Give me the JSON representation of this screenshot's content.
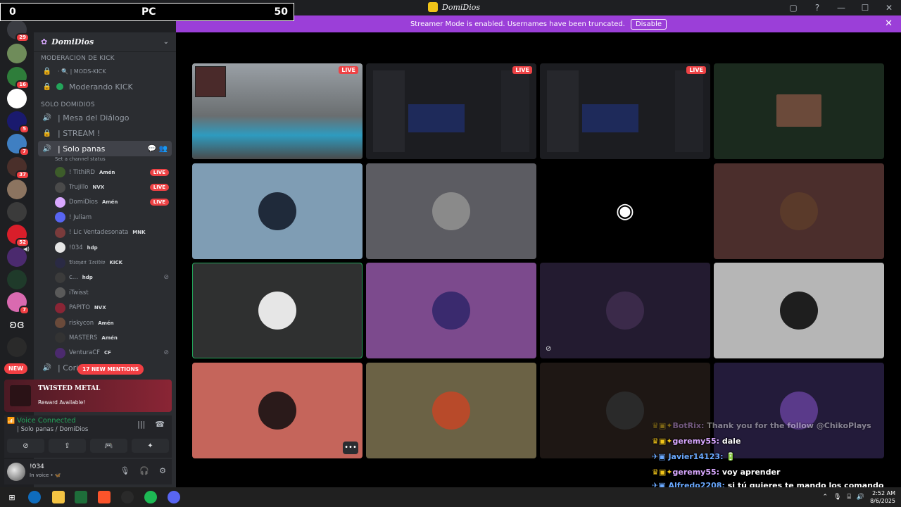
{
  "window": {
    "title": "DomiDios",
    "controls": [
      "▢",
      "?",
      "—",
      "☐",
      "✕"
    ]
  },
  "score_overlay": {
    "left": "0",
    "mid": "PC",
    "right": "50"
  },
  "streamer_bar": {
    "message": "Streamer Mode is enabled. Usernames have been truncated.",
    "button": "Disable",
    "close": "✕"
  },
  "server_rail": {
    "badges": [
      "29",
      "16",
      "5",
      "7",
      "37",
      "52",
      "7"
    ],
    "new_label": "NEW"
  },
  "sidebar": {
    "server_name": "DomiDios",
    "categories": [
      "MODERACION DE KICK",
      "SOLO DOMIDIOS"
    ],
    "channels_mod": [
      {
        "icon": "🔒",
        "label": "· 🔍 | MODS-KICK"
      },
      {
        "icon": "🔒",
        "label": "Moderando KICK"
      }
    ],
    "channels_solo": [
      {
        "icon": "🔊",
        "label": "| Mesa del Diálogo"
      },
      {
        "icon": "🔒",
        "label": "| STREAM !"
      },
      {
        "icon": "🔊",
        "label": "| Solo panas"
      }
    ],
    "channel_status": "Set a channel status",
    "voice_users": [
      {
        "name": "! TithiRD",
        "tag": "Amén",
        "live": "LIVE"
      },
      {
        "name": "Trujillo",
        "tag": "NVX",
        "live": "LIVE"
      },
      {
        "name": "DomiDios",
        "tag": "Amén",
        "live": "LIVE"
      },
      {
        "name": "! Juliam",
        "tag": "",
        "live": ""
      },
      {
        "name": "! Lic Ventadesonata",
        "tag": "MNK",
        "live": ""
      },
      {
        "name": "!034",
        "tag": "hdp",
        "live": ""
      },
      {
        "name": "𝔅𝔯𝔞𝔶𝔞𝔫 𝔗𝔬𝔯𝔦𝔟𝔦𝔬",
        "tag": "KICK",
        "live": ""
      },
      {
        "name": "c...",
        "tag": "hdp",
        "live": ""
      },
      {
        "name": "iTwisst",
        "tag": "",
        "live": ""
      },
      {
        "name": "PAPITO",
        "tag": "NVX",
        "live": ""
      },
      {
        "name": "riskycon",
        "tag": "Amén",
        "live": ""
      },
      {
        "name": "MASTERS",
        "tag": "Amén",
        "live": ""
      },
      {
        "name": "VenturaCF",
        "tag": "CF",
        "live": ""
      }
    ],
    "last_channel": "| Corito",
    "mentions_pill": "17 NEW MENTIONS"
  },
  "reward": {
    "title": "TWISTED METAL",
    "subtitle": "Reward Available!"
  },
  "voice_panel": {
    "status": "Voice Connected",
    "location": "| Solo panas / DomiDios",
    "buttons": [
      "⊘",
      "⇪",
      "🎮",
      "✦"
    ]
  },
  "user_panel": {
    "name": "!034",
    "status": "In voice • 🦋"
  },
  "tiles": [
    {
      "type": "stream",
      "live": "LIVE"
    },
    {
      "type": "screen",
      "live": "LIVE"
    },
    {
      "type": "screen",
      "live": "LIVE"
    },
    {
      "type": "camera",
      "live": ""
    },
    {
      "type": "avatar",
      "live": ""
    },
    {
      "type": "avatar",
      "live": ""
    },
    {
      "type": "discord",
      "live": ""
    },
    {
      "type": "avatar",
      "live": ""
    },
    {
      "type": "avatar",
      "live": ""
    },
    {
      "type": "avatar",
      "live": ""
    },
    {
      "type": "avatar",
      "live": ""
    },
    {
      "type": "avatar",
      "live": ""
    },
    {
      "type": "avatar",
      "live": ""
    },
    {
      "type": "avatar",
      "live": ""
    },
    {
      "type": "avatar",
      "live": ""
    },
    {
      "type": "avatar",
      "live": ""
    }
  ],
  "tile_colors": [
    "#7a8a6a",
    "#1c1d21",
    "#1c1d21",
    "#1b2a1e",
    "#7f9db4",
    "#5c5c62",
    "#000000",
    "#4b2e2c",
    "#2f3030",
    "#7c4a8d",
    "#231b30",
    "#b6b6b6",
    "#c5655b",
    "#6b6245",
    "#1e1714",
    "#231b3a"
  ],
  "chat": [
    {
      "user": "BotRix:",
      "msg": " Thank you for the follow @ChikoPlays",
      "faded": true,
      "blue": false
    },
    {
      "user": "geremy55:",
      "msg": " dale",
      "faded": false,
      "blue": false
    },
    {
      "user": "Javier14123:",
      "msg": " 🔋",
      "faded": false,
      "blue": true
    },
    {
      "user": "geremy55:",
      "msg": " voy aprender",
      "faded": false,
      "blue": false
    },
    {
      "user": "Alfredo2208:",
      "msg": " si tú quieres te mando los comando básico para mod y te los aprende",
      "faded": false,
      "blue": true
    }
  ],
  "taskbar": {
    "time": "2:52 AM",
    "date": "8/6/2025"
  },
  "colors": {
    "accent": "#9b3fd8",
    "live": "#ed4245",
    "voice_green": "#23a55a"
  }
}
